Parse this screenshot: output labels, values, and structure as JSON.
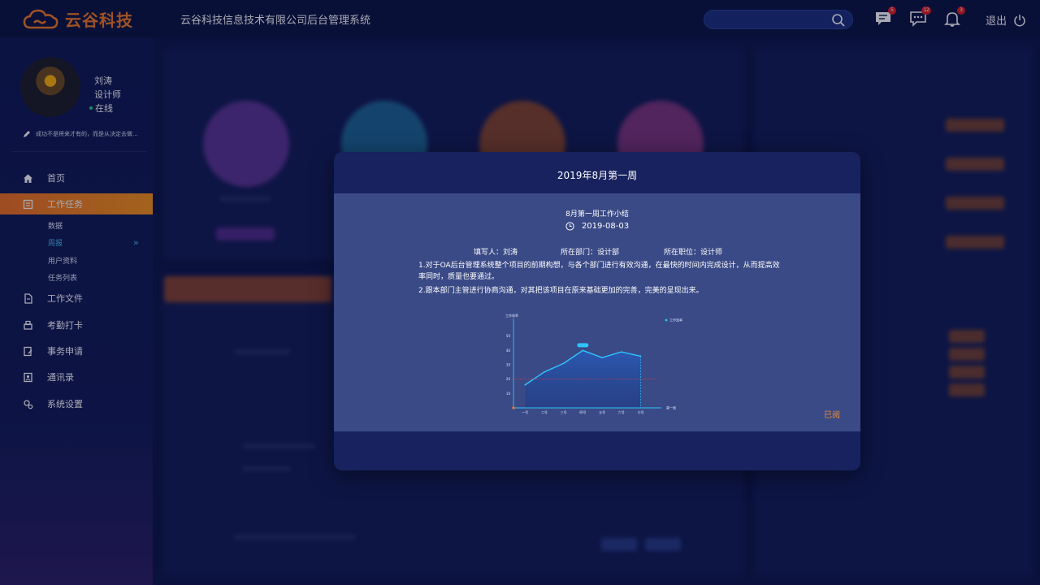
{
  "header": {
    "brand": "云谷科技",
    "system_title": "云谷科技信息技术有限公司后台管理系统",
    "search_placeholder": "",
    "messages_badge": "5",
    "chat_badge": "12",
    "notifications_badge": "3",
    "logout_label": "退出"
  },
  "user": {
    "name": "刘涛",
    "role": "设计师",
    "status": "在线",
    "motto": "成功不是将来才有的，而是从决定去做..."
  },
  "sidebar": {
    "items": [
      {
        "label": "首页",
        "icon": "home-icon"
      },
      {
        "label": "工作任务",
        "icon": "task-icon",
        "active": true
      },
      {
        "label": "工作文件",
        "icon": "file-icon"
      },
      {
        "label": "考勤打卡",
        "icon": "attendance-icon"
      },
      {
        "label": "事务申请",
        "icon": "application-icon"
      },
      {
        "label": "通讯录",
        "icon": "contacts-icon"
      },
      {
        "label": "系统设置",
        "icon": "settings-icon"
      }
    ],
    "sub_items": [
      "数据",
      "周报",
      "用户资料",
      "任务列表"
    ]
  },
  "modal": {
    "title": "2019年8月第一周",
    "subtitle": "8月第一周工作小结",
    "date": "2019-08-03",
    "author": "填写人：刘涛",
    "department": "所在部门：设计部",
    "position": "所在职位：设计师",
    "line1": "1.对于OA后台管理系统整个项目的前期构想，与各个部门进行有效沟通，在最快的时间内完成设计，从而提高效率同时，质量也要通过。",
    "line2": "2.跟本部门主管进行协商沟通，对其把该项目在原来基础更加的完善，完美的呈现出来。",
    "read_status": "已阅"
  },
  "chart_data": {
    "type": "area",
    "ylabel": "工作效率",
    "xlabel": "第一周",
    "categories": [
      "一号",
      "二号",
      "三号",
      "四号",
      "五号",
      "六号",
      "七号"
    ],
    "series": [
      {
        "name": "工作效率",
        "values": [
          16,
          25,
          31,
          40,
          35,
          39,
          36
        ]
      }
    ],
    "y_ticks": [
      10,
      20,
      30,
      40,
      50
    ],
    "ylim": [
      0,
      60
    ],
    "reference_line": {
      "value": 20
    },
    "peak_label": "",
    "legend": "top-right",
    "colors": {
      "line": "#2fc4ff",
      "area": "#1d3b86",
      "reference": "#e53a3a"
    }
  }
}
